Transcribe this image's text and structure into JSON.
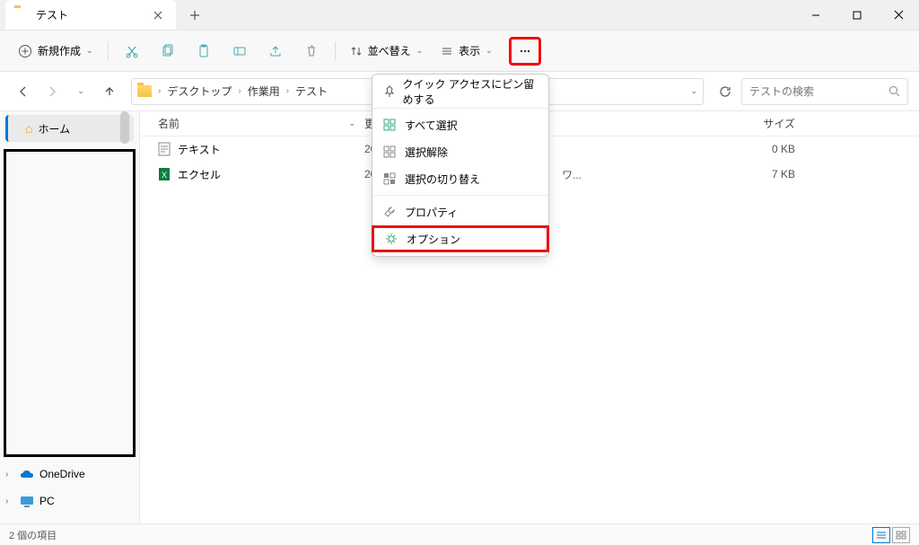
{
  "tab": {
    "title": "テスト"
  },
  "toolbar": {
    "new_label": "新規作成",
    "sort_label": "並べ替え",
    "view_label": "表示"
  },
  "breadcrumb": {
    "items": [
      "デスクトップ",
      "作業用",
      "テスト"
    ]
  },
  "search": {
    "placeholder": "テストの検索"
  },
  "sidebar": {
    "home": "ホーム",
    "onedrive": "OneDrive",
    "pc": "PC"
  },
  "columns": {
    "name": "名前",
    "date": "更",
    "type": "",
    "size": "サイズ"
  },
  "files": [
    {
      "icon": "text",
      "name": "テキスト",
      "date": "20",
      "type": "",
      "size": "0 KB"
    },
    {
      "icon": "excel",
      "name": "エクセル",
      "date": "20",
      "type": "ワ...",
      "size": "7 KB"
    }
  ],
  "menu": {
    "pin": "クイック アクセスにピン留めする",
    "select_all": "すべて選択",
    "select_none": "選択解除",
    "invert": "選択の切り替え",
    "properties": "プロパティ",
    "options": "オプション"
  },
  "status": {
    "text": "2 個の項目"
  }
}
